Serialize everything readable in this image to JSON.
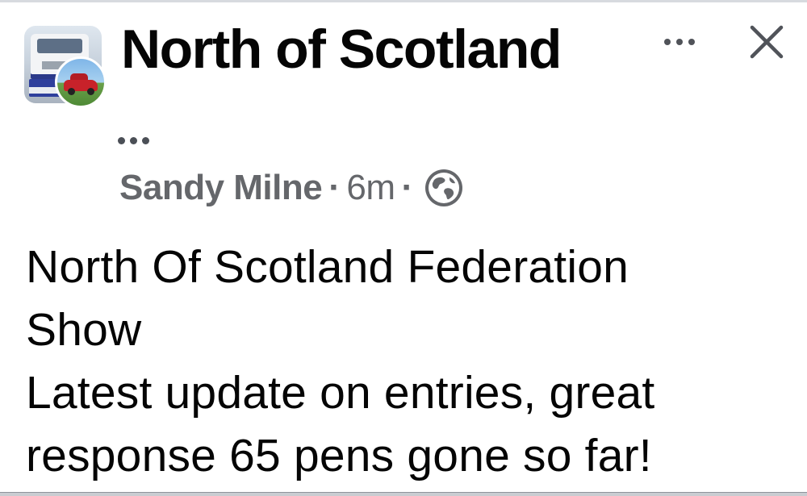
{
  "header": {
    "group_name": "North of Scotland",
    "more_icon": "more-horizontal-icon",
    "close_icon": "close-icon"
  },
  "post": {
    "author": "Sandy Milne",
    "separator": "·",
    "time": "6m",
    "audience_icon": "globe-icon",
    "lines": [
      "North Of Scotland Federation",
      "Show",
      "Latest update on entries, great",
      "response 65 pens gone so far!"
    ]
  },
  "colors": {
    "text_primary": "#050505",
    "text_secondary": "#65676b",
    "icon": "#505359"
  }
}
